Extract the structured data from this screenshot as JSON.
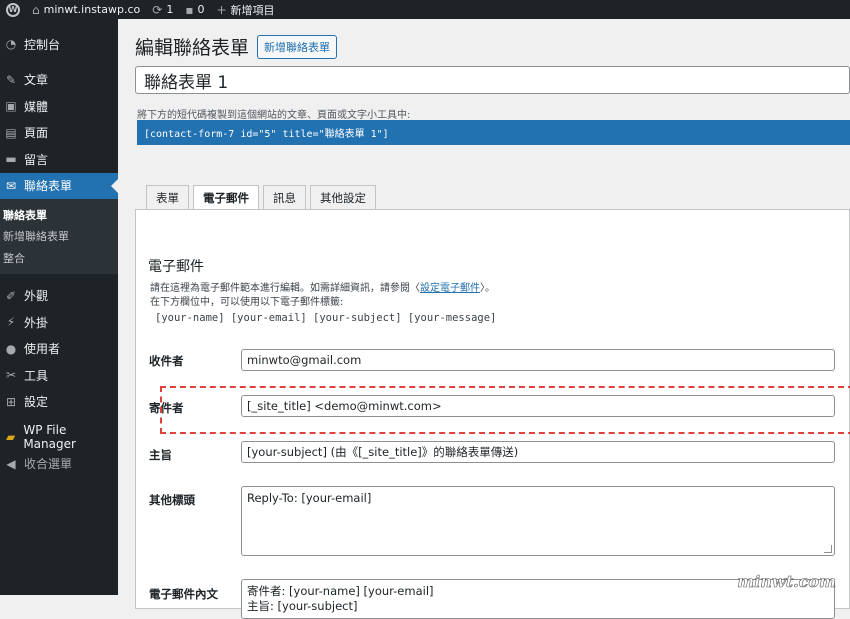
{
  "adminbar": {
    "site_name": "minwt.instawp.co",
    "updates_count": "1",
    "comments_count": "0",
    "new_label": "新增項目"
  },
  "sidebar": {
    "items": [
      {
        "label": "控制台",
        "icon": "dashboard-icon"
      },
      {
        "label": "文章",
        "icon": "pin-icon"
      },
      {
        "label": "媒體",
        "icon": "media-icon"
      },
      {
        "label": "頁面",
        "icon": "page-icon"
      },
      {
        "label": "留言",
        "icon": "comment-icon"
      },
      {
        "label": "聯絡表單",
        "icon": "mail-icon"
      },
      {
        "label": "外觀",
        "icon": "brush-icon"
      },
      {
        "label": "外掛",
        "icon": "plugin-icon"
      },
      {
        "label": "使用者",
        "icon": "user-icon"
      },
      {
        "label": "工具",
        "icon": "wrench-icon"
      },
      {
        "label": "設定",
        "icon": "settings-icon"
      },
      {
        "label": "WP File Manager",
        "icon": "folder-icon"
      },
      {
        "label": "收合選單",
        "icon": "collapse-icon"
      }
    ],
    "submenu": [
      "聯絡表單",
      "新增聯絡表單",
      "整合"
    ]
  },
  "main": {
    "page_title": "編輯聯絡表單",
    "add_new_label": "新增聯絡表單",
    "form_title": "聯絡表單 1",
    "shortcode_hint": "將下方的短代碼複製到這個網站的文章、頁面或文字小工具中:",
    "shortcode": "[contact-form-7 id=\"5\" title=\"聯絡表單 1\"]",
    "tabs": [
      "表單",
      "電子郵件",
      "訊息",
      "其他設定"
    ],
    "active_tab": "電子郵件"
  },
  "mail": {
    "heading": "電子郵件",
    "desc_line1_prefix": "請在這裡為電子郵件範本進行編輯。如需詳細資訊，請參閱〈",
    "desc_link": "設定電子郵件",
    "desc_line1_suffix": "〉。",
    "desc_line2": "在下方欄位中，可以使用以下電子郵件標籤:",
    "tags": "[your-name] [your-email] [your-subject] [your-message]",
    "fields": {
      "to_label": "收件者",
      "to_value": "minwto@gmail.com",
      "from_label": "寄件者",
      "from_value": "[_site_title] <demo@minwt.com>",
      "subject_label": "主旨",
      "subject_value": "[your-subject] (由《[_site_title]》的聯絡表單傳送)",
      "headers_label": "其他標頭",
      "headers_value": "Reply-To: [your-email]",
      "body_label": "電子郵件內文",
      "body_line1": "寄件者: [your-name] [your-email]",
      "body_line2": "主旨: [your-subject]"
    }
  },
  "watermark": "minwt.com"
}
